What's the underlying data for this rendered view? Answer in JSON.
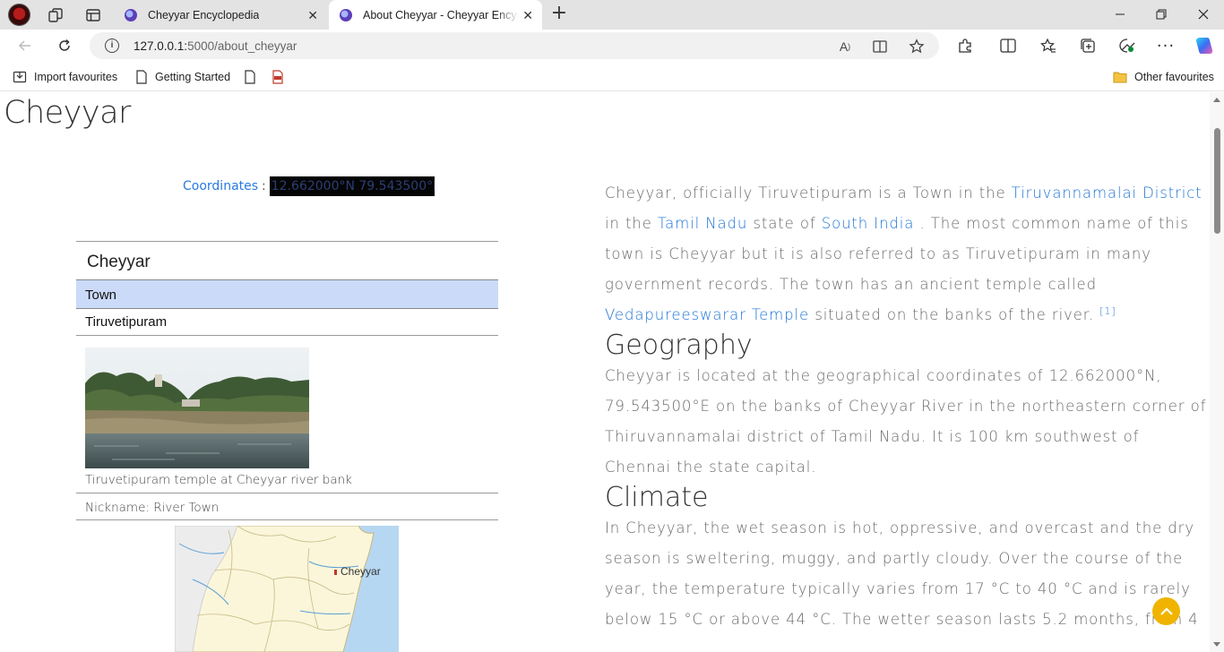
{
  "browser": {
    "tabs": [
      {
        "title": "Cheyyar Encyclopedia"
      },
      {
        "title": "About Cheyyar - Cheyyar Encyclopedia"
      }
    ],
    "url_host": "127.0.0.1:",
    "url_rest": "5000/about_cheyyar",
    "favourites": [
      {
        "label": "Import favourites"
      },
      {
        "label": "Getting Started"
      }
    ],
    "other_favourites": "Other favourites"
  },
  "page": {
    "title": "Cheyyar",
    "coordinates_label": "Coordinates",
    "coordinates_sep": ":",
    "coordinates_value": "12.662000°N 79.543500°E",
    "infobox": {
      "name": "Cheyyar",
      "type": "Town",
      "alt_name": "Tiruvetipuram",
      "photo_caption": "Tiruvetipuram temple at Cheyyar river bank",
      "nickname": "Nickname: River Town",
      "map_label": "Cheyyar"
    },
    "intro": {
      "t1": "Cheyyar, officially Tiruvetipuram is a Town in the ",
      "link1": "Tiruvannamalai District",
      "t2": " in the ",
      "link2": "Tamil Nadu",
      "t3": " state of ",
      "link3": "South India",
      "t4": " . The most common name of this town is Cheyyar but it is also referred to as Tiruvetipuram in many government records. The town has an ancient temple called ",
      "link4": "Vedapureeswarar Temple",
      "t5": " situated on the banks of the river. ",
      "ref": "[1]"
    },
    "geography": {
      "heading": "Geography",
      "text": "Cheyyar is located at the geographical coordinates of 12.662000°N, 79.543500°E on the banks of Cheyyar River in the northeastern corner of Thiruvannamalai district of Tamil Nadu. It is 100 km southwest of Chennai the state capital."
    },
    "climate": {
      "heading": "Climate",
      "text": "In Cheyyar, the wet season is hot, oppressive, and overcast and the dry season is sweltering, muggy, and partly cloudy. Over the course of the year, the temperature typically varies from 17 °C to 40 °C and is rarely below 15 °C or above 44 °C. The wetter season lasts 5.2 months, from 4"
    }
  },
  "colors": {
    "link": "#1e73d6",
    "infobox_highlight": "#cbdaf8",
    "scroll_top_button": "#f0b400"
  }
}
